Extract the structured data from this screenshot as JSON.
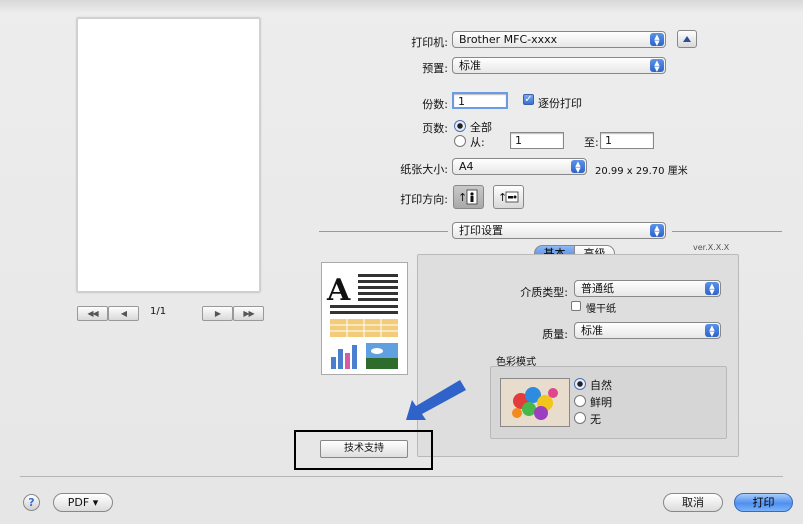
{
  "preview": {
    "page_counter": "1/1"
  },
  "printer": {
    "label": "打印机:",
    "value": "Brother MFC-xxxx"
  },
  "presets": {
    "label": "预置:",
    "value": "标准"
  },
  "copies": {
    "label": "份数:",
    "value": "1",
    "collated_label": "逐份打印"
  },
  "pages": {
    "label": "页数:",
    "all_label": "全部",
    "from_label": "从:",
    "from_value": "1",
    "to_label": "至:",
    "to_value": "1"
  },
  "paper_size": {
    "label": "纸张大小:",
    "value": "A4",
    "dimensions": "20.99 x 29.70 厘米"
  },
  "orientation": {
    "label": "打印方向:"
  },
  "pane": {
    "value": "打印设置"
  },
  "tabs": {
    "basic": "基本",
    "advanced": "高级",
    "version": "ver.X.X.X"
  },
  "media_type": {
    "label": "介质类型:",
    "value": "普通纸",
    "slow_dry_label": "慢干纸"
  },
  "quality": {
    "label": "质量:",
    "value": "标准"
  },
  "color_mode": {
    "title": "色彩模式",
    "options": [
      "自然",
      "鲜明",
      "无"
    ]
  },
  "support_button": "技术支持",
  "footer": {
    "help": "?",
    "pdf_label": "PDF ▾",
    "cancel_label": "取消",
    "print_label": "打印"
  },
  "colors": {
    "accent": "#3b73d9",
    "arrow": "#2f63c9",
    "highlight_box": "#000000"
  }
}
